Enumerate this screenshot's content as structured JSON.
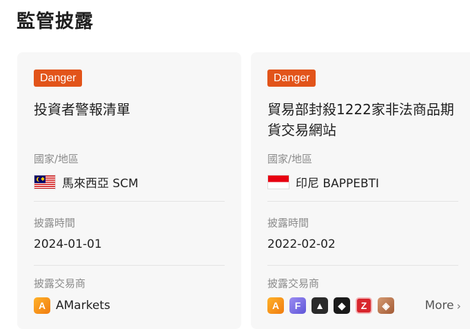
{
  "page": {
    "title": "監管披露"
  },
  "cards": [
    {
      "badge": "Danger",
      "title": "投資者警報清單",
      "region_label": "國家/地區",
      "region_value": "馬來西亞 SCM",
      "flag_icon": "malaysia-flag-icon",
      "date_label": "披露時間",
      "date_value": "2024-01-01",
      "brokers_label": "披露交易商",
      "brokers": [
        {
          "icon": "amarkets-logo-icon",
          "glyph": "A",
          "name": "AMarkets"
        }
      ]
    },
    {
      "badge": "Danger",
      "title": "貿易部封殺1222家非法商品期貨交易網站",
      "region_label": "國家/地區",
      "region_value": "印尼 BAPPEBTI",
      "flag_icon": "indonesia-flag-icon",
      "date_label": "披露時間",
      "date_value": "2022-02-02",
      "brokers_label": "披露交易商",
      "brokers": [
        {
          "icon": "amarkets-logo-icon",
          "glyph": "A"
        },
        {
          "icon": "f-broker-logo-icon",
          "glyph": "F"
        },
        {
          "icon": "triangle-broker-logo-icon",
          "glyph": "▲"
        },
        {
          "icon": "dark-broker-logo-icon",
          "glyph": "◆"
        },
        {
          "icon": "z-broker-logo-icon",
          "glyph": "Z"
        },
        {
          "icon": "brown-broker-logo-icon",
          "glyph": "◈"
        }
      ],
      "more_label": "More",
      "more_icon": "chevron-right-icon"
    }
  ],
  "colors": {
    "badge_bg": "#e2541a",
    "card_bg": "#f7f7f7",
    "label": "#8a8a8a"
  }
}
